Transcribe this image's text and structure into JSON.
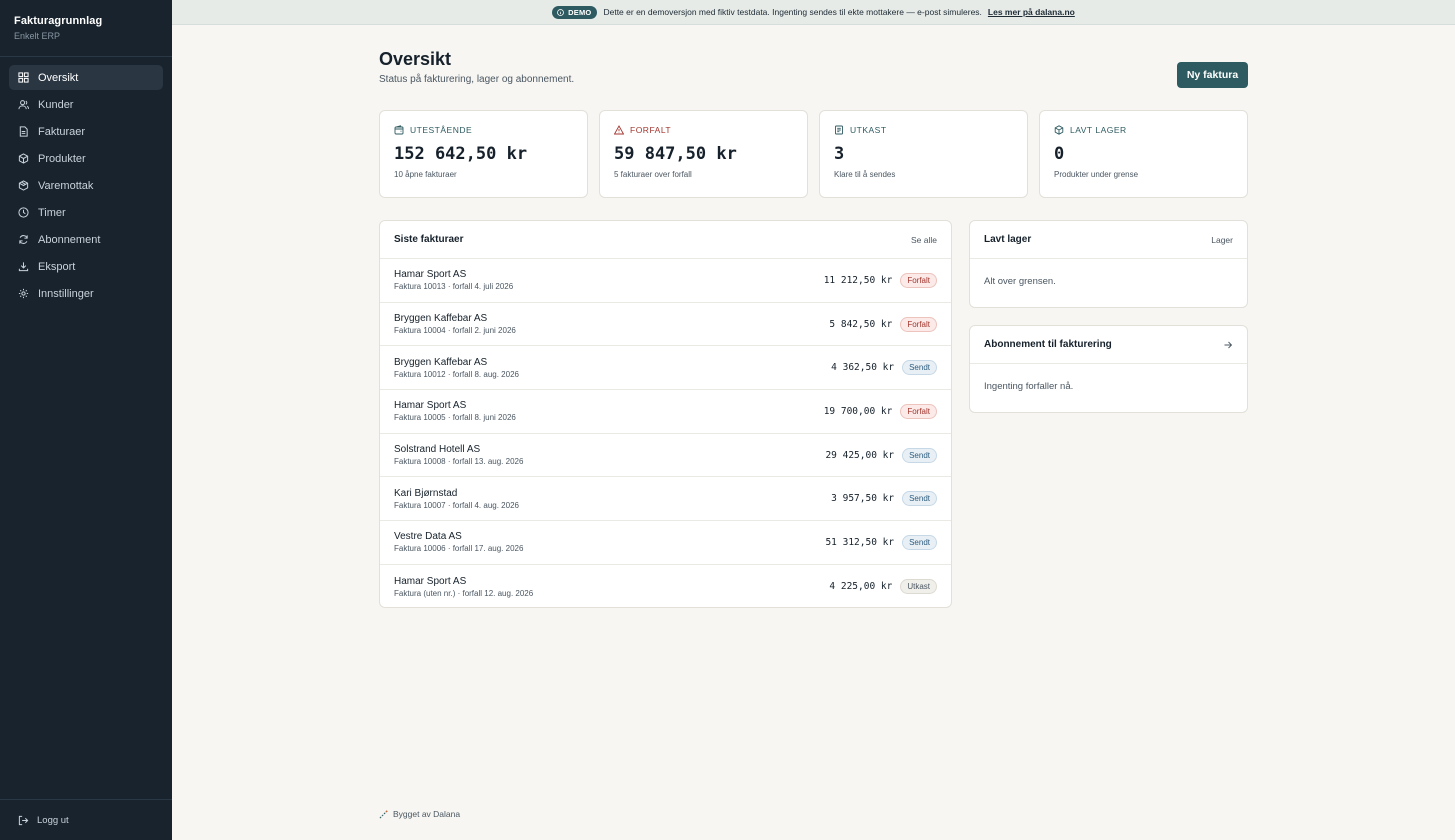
{
  "sidebar": {
    "title": "Fakturagrunnlag",
    "subtitle": "Enkelt ERP",
    "items": [
      {
        "label": "Oversikt",
        "icon": "grid-icon"
      },
      {
        "label": "Kunder",
        "icon": "users-icon"
      },
      {
        "label": "Fakturaer",
        "icon": "file-icon"
      },
      {
        "label": "Produkter",
        "icon": "box-icon"
      },
      {
        "label": "Varemottak",
        "icon": "package-icon"
      },
      {
        "label": "Timer",
        "icon": "clock-icon"
      },
      {
        "label": "Abonnement",
        "icon": "refresh-icon"
      },
      {
        "label": "Eksport",
        "icon": "download-icon"
      },
      {
        "label": "Innstillinger",
        "icon": "gear-icon"
      }
    ],
    "logout": "Logg ut"
  },
  "banner": {
    "badge": "DEMO",
    "text": "Dette er en demoversjon med fiktiv testdata. Ingenting sendes til ekte mottakere — e-post simuleres.",
    "link": "Les mer på dalana.no"
  },
  "header": {
    "title": "Oversikt",
    "subtitle": "Status på fakturering, lager og abonnement.",
    "new_invoice": "Ny faktura"
  },
  "stats": [
    {
      "label": "UTESTÅENDE",
      "value": "152 642,50 kr",
      "note": "10 åpne fakturaer",
      "icon": "wallet-icon"
    },
    {
      "label": "FORFALT",
      "value": "59 847,50 kr",
      "note": "5 fakturaer over forfall",
      "icon": "warning-icon"
    },
    {
      "label": "UTKAST",
      "value": "3",
      "note": "Klare til å sendes",
      "icon": "draft-icon"
    },
    {
      "label": "LAVT LAGER",
      "value": "0",
      "note": "Produkter under grense",
      "icon": "box-icon"
    }
  ],
  "invoices": {
    "title": "Siste fakturaer",
    "see_all": "Se alle",
    "rows": [
      {
        "customer": "Hamar Sport AS",
        "meta": "Faktura 10013 · forfall 4. juli 2026",
        "amount": "11 212,50 kr",
        "status": "Forfalt"
      },
      {
        "customer": "Bryggen Kaffebar AS",
        "meta": "Faktura 10004 · forfall 2. juni 2026",
        "amount": "5 842,50 kr",
        "status": "Forfalt"
      },
      {
        "customer": "Bryggen Kaffebar AS",
        "meta": "Faktura 10012 · forfall 8. aug. 2026",
        "amount": "4 362,50 kr",
        "status": "Sendt"
      },
      {
        "customer": "Hamar Sport AS",
        "meta": "Faktura 10005 · forfall 8. juni 2026",
        "amount": "19 700,00 kr",
        "status": "Forfalt"
      },
      {
        "customer": "Solstrand Hotell AS",
        "meta": "Faktura 10008 · forfall 13. aug. 2026",
        "amount": "29 425,00 kr",
        "status": "Sendt"
      },
      {
        "customer": "Kari Bjørnstad",
        "meta": "Faktura 10007 · forfall 4. aug. 2026",
        "amount": "3 957,50 kr",
        "status": "Sendt"
      },
      {
        "customer": "Vestre Data AS",
        "meta": "Faktura 10006 · forfall 17. aug. 2026",
        "amount": "51 312,50 kr",
        "status": "Sendt"
      },
      {
        "customer": "Hamar Sport AS",
        "meta": "Faktura (uten nr.) · forfall 12. aug. 2026",
        "amount": "4 225,00 kr",
        "status": "Utkast"
      }
    ]
  },
  "low_stock": {
    "title": "Lavt lager",
    "link": "Lager",
    "empty": "Alt over grensen."
  },
  "subscriptions": {
    "title": "Abonnement til fakturering",
    "empty": "Ingenting forfaller nå."
  },
  "footer": {
    "text": "Bygget av Dalana"
  },
  "colors": {
    "accent": "#2e5b61",
    "sidebar": "#18232d",
    "danger": "#a3362f",
    "info": "#2f5d7d"
  }
}
